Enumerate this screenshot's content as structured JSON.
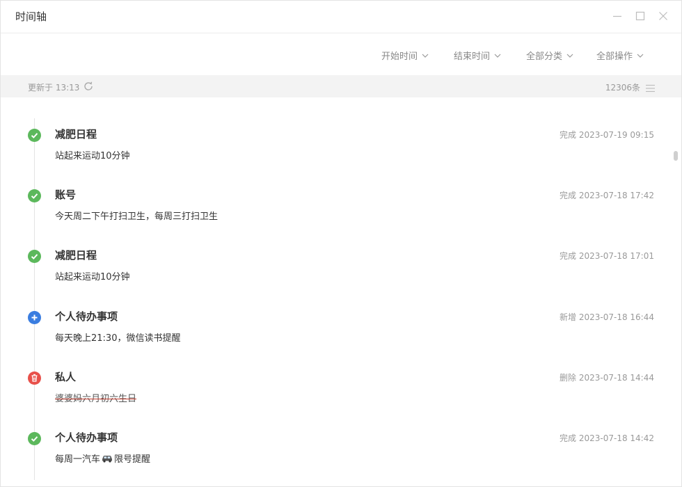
{
  "window": {
    "title": "时间轴"
  },
  "filters": {
    "start_time": "开始时间",
    "end_time": "结束时间",
    "category": "全部分类",
    "operation": "全部操作"
  },
  "status": {
    "updated": "更新于 13:13",
    "count": "12306条"
  },
  "items": [
    {
      "type": "done",
      "title": "减肥日程",
      "time": "完成 2023-07-19 09:15",
      "desc": "站起来运动10分钟"
    },
    {
      "type": "done",
      "title": "账号",
      "time": "完成 2023-07-18 17:42",
      "desc": "今天周二下午打扫卫生，每周三打扫卫生"
    },
    {
      "type": "done",
      "title": "减肥日程",
      "time": "完成 2023-07-18 17:01",
      "desc": "站起来运动10分钟"
    },
    {
      "type": "add",
      "title": "个人待办事项",
      "time": "新增 2023-07-18 16:44",
      "desc": "每天晚上21:30，微信读书提醒"
    },
    {
      "type": "delete",
      "title": "私人",
      "time": "删除 2023-07-18 14:44",
      "desc": "婆婆妈六月初六生日"
    },
    {
      "type": "done",
      "title": "个人待办事项",
      "time": "完成 2023-07-18 14:42",
      "desc_before": "每周一汽车",
      "desc_after": "限号提醒"
    }
  ],
  "colors": {
    "done": "#5cb85c",
    "add": "#3a7de0",
    "delete": "#e8504a"
  },
  "icons": {
    "done": "check-circle-icon",
    "add": "plus-circle-icon",
    "delete": "trash-circle-icon",
    "car": "car-emoji-icon"
  }
}
